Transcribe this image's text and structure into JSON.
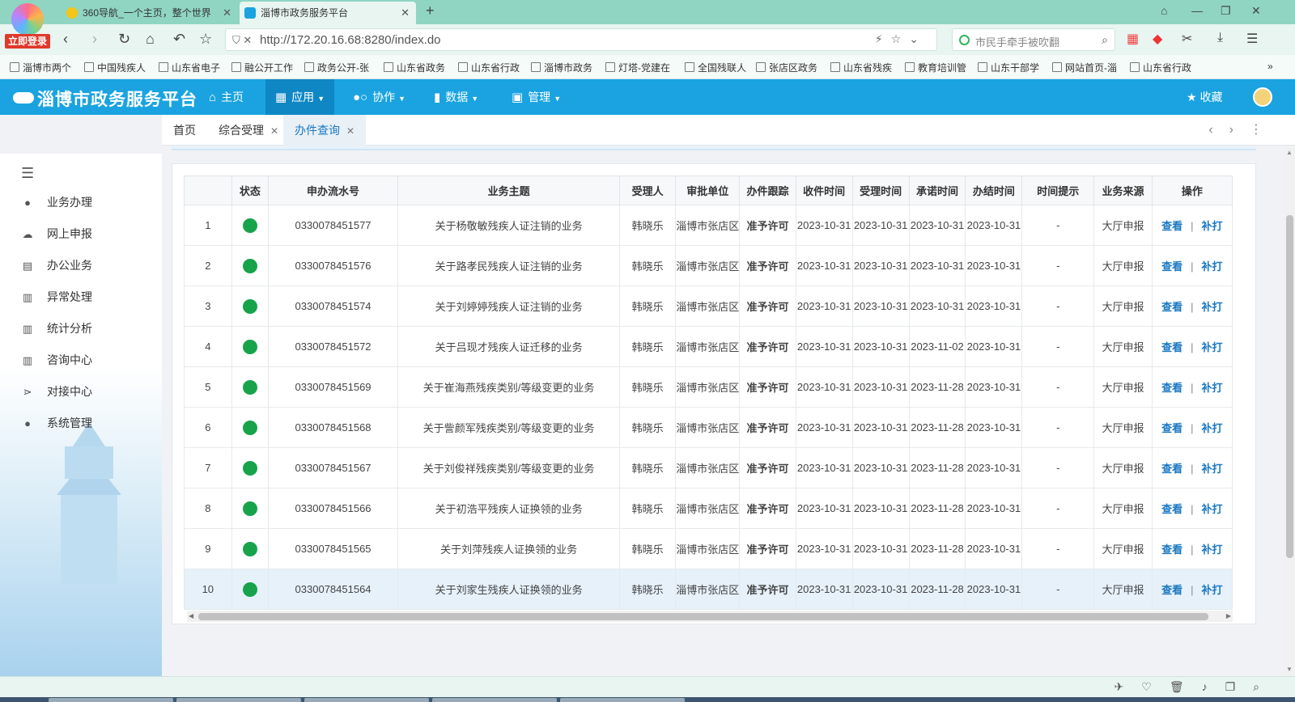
{
  "browser": {
    "login_label": "立即登录",
    "tabs": [
      {
        "title": "360导航_一个主页，整个世界",
        "color": "#f5c518"
      },
      {
        "title": "淄博市政务服务平台",
        "color": "#1aa3e0"
      }
    ],
    "url": "http://172.20.16.68:8280/index.do",
    "search_placeholder": "市民手牵手被吹翻",
    "bookmarks": [
      "淄博市两个",
      "中国残疾人",
      "山东省电子",
      "融公开工作",
      "政务公开-张",
      "山东省政务",
      "山东省行政",
      "淄博市政务",
      "灯塔-党建在",
      "全国残联人",
      "张店区政务",
      "山东省残疾",
      "教育培训管",
      "山东干部学",
      "网站首页-淄",
      "山东省行政"
    ]
  },
  "app": {
    "title": "淄博市政务服务平台",
    "nav": [
      {
        "label": "主页",
        "icon": "home-icon"
      },
      {
        "label": "应用",
        "icon": "grid-icon"
      },
      {
        "label": "协作",
        "icon": "toggle-icon"
      },
      {
        "label": "数据",
        "icon": "bar-chart-icon"
      },
      {
        "label": "管理",
        "icon": "manage-icon"
      }
    ],
    "favorite_label": "收藏",
    "accent": "#1aa3e0"
  },
  "sidebar": {
    "items": [
      {
        "label": "业务办理",
        "icon": "user-icon"
      },
      {
        "label": "网上申报",
        "icon": "cloud-icon"
      },
      {
        "label": "办公业务",
        "icon": "comment-icon"
      },
      {
        "label": "异常处理",
        "icon": "chart-icon"
      },
      {
        "label": "统计分析",
        "icon": "chart-icon"
      },
      {
        "label": "咨询中心",
        "icon": "chart-icon"
      },
      {
        "label": "对接中心",
        "icon": "share-icon"
      },
      {
        "label": "系统管理",
        "icon": "alert-icon"
      }
    ]
  },
  "content_tabs": [
    {
      "label": "首页",
      "closable": false
    },
    {
      "label": "综合受理",
      "closable": true
    },
    {
      "label": "办件查询",
      "closable": true
    }
  ],
  "table": {
    "columns": [
      "",
      "状态",
      "申办流水号",
      "业务主题",
      "受理人",
      "审批单位",
      "办件跟踪",
      "收件时间",
      "受理时间",
      "承诺时间",
      "办结时间",
      "时间提示",
      "业务来源",
      "操作"
    ],
    "view_label": "查看",
    "extra_label": "补打",
    "rows": [
      {
        "no": "1",
        "serial": "0330078451577",
        "subject": "关于杨敬敏残疾人证注销的业务",
        "handler": "韩晓乐",
        "unit": "淄博市张店区",
        "track": "准予许可",
        "recv": "2023-10-31",
        "accept": "2023-10-31",
        "promise": "2023-10-31",
        "done": "2023-10-31",
        "hint": "-",
        "source": "大厅申报"
      },
      {
        "no": "2",
        "serial": "0330078451576",
        "subject": "关于路孝民残疾人证注销的业务",
        "handler": "韩晓乐",
        "unit": "淄博市张店区",
        "track": "准予许可",
        "recv": "2023-10-31",
        "accept": "2023-10-31",
        "promise": "2023-10-31",
        "done": "2023-10-31",
        "hint": "-",
        "source": "大厅申报"
      },
      {
        "no": "3",
        "serial": "0330078451574",
        "subject": "关于刘婷婷残疾人证注销的业务",
        "handler": "韩晓乐",
        "unit": "淄博市张店区",
        "track": "准予许可",
        "recv": "2023-10-31",
        "accept": "2023-10-31",
        "promise": "2023-10-31",
        "done": "2023-10-31",
        "hint": "-",
        "source": "大厅申报"
      },
      {
        "no": "4",
        "serial": "0330078451572",
        "subject": "关于吕现才残疾人证迁移的业务",
        "handler": "韩晓乐",
        "unit": "淄博市张店区",
        "track": "准予许可",
        "recv": "2023-10-31",
        "accept": "2023-10-31",
        "promise": "2023-11-02",
        "done": "2023-10-31",
        "hint": "-",
        "source": "大厅申报"
      },
      {
        "no": "5",
        "serial": "0330078451569",
        "subject": "关于崔海燕残疾类别/等级变更的业务",
        "handler": "韩晓乐",
        "unit": "淄博市张店区",
        "track": "准予许可",
        "recv": "2023-10-31",
        "accept": "2023-10-31",
        "promise": "2023-11-28",
        "done": "2023-10-31",
        "hint": "-",
        "source": "大厅申报"
      },
      {
        "no": "6",
        "serial": "0330078451568",
        "subject": "关于訾颜军残疾类别/等级变更的业务",
        "handler": "韩晓乐",
        "unit": "淄博市张店区",
        "track": "准予许可",
        "recv": "2023-10-31",
        "accept": "2023-10-31",
        "promise": "2023-11-28",
        "done": "2023-10-31",
        "hint": "-",
        "source": "大厅申报"
      },
      {
        "no": "7",
        "serial": "0330078451567",
        "subject": "关于刘俊祥残疾类别/等级变更的业务",
        "handler": "韩晓乐",
        "unit": "淄博市张店区",
        "track": "准予许可",
        "recv": "2023-10-31",
        "accept": "2023-10-31",
        "promise": "2023-11-28",
        "done": "2023-10-31",
        "hint": "-",
        "source": "大厅申报"
      },
      {
        "no": "8",
        "serial": "0330078451566",
        "subject": "关于初浩平残疾人证换领的业务",
        "handler": "韩晓乐",
        "unit": "淄博市张店区",
        "track": "准予许可",
        "recv": "2023-10-31",
        "accept": "2023-10-31",
        "promise": "2023-11-28",
        "done": "2023-10-31",
        "hint": "-",
        "source": "大厅申报"
      },
      {
        "no": "9",
        "serial": "0330078451565",
        "subject": "关于刘萍残疾人证换领的业务",
        "handler": "韩晓乐",
        "unit": "淄博市张店区",
        "track": "准予许可",
        "recv": "2023-10-31",
        "accept": "2023-10-31",
        "promise": "2023-11-28",
        "done": "2023-10-31",
        "hint": "-",
        "source": "大厅申报"
      },
      {
        "no": "10",
        "serial": "0330078451564",
        "subject": "关于刘家生残疾人证换领的业务",
        "handler": "韩晓乐",
        "unit": "淄博市张店区",
        "track": "准予许可",
        "recv": "2023-10-31",
        "accept": "2023-10-31",
        "promise": "2023-11-28",
        "done": "2023-10-31",
        "hint": "-",
        "source": "大厅申报"
      }
    ]
  }
}
